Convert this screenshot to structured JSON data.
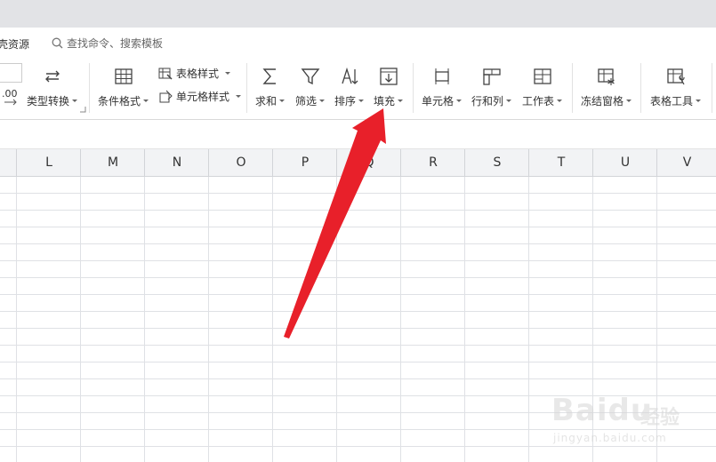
{
  "menu": {
    "resource_fragment": "壳资源",
    "search_placeholder": "查找命令、搜索模板"
  },
  "ribbon": {
    "type_convert": "类型转换",
    "conditional_format": "条件格式",
    "table_style": "表格样式",
    "cell_style": "单元格样式",
    "sum": "求和",
    "filter": "筛选",
    "sort": "排序",
    "fill": "填充",
    "cell": "单元格",
    "row_col": "行和列",
    "worksheet": "工作表",
    "freeze": "冻结窗格",
    "table_tools": "表格工具",
    "decimal_fragment": ".00"
  },
  "columns": [
    "L",
    "M",
    "N",
    "O",
    "P",
    "Q",
    "R",
    "S",
    "T",
    "U",
    "V"
  ],
  "watermark": {
    "brand": "Baidu",
    "cn": "经验",
    "url": "jingyan.baidu.com"
  },
  "colors": {
    "arrow": "#e8202a",
    "titlebar": "#e2e3e6",
    "header": "#f2f3f5",
    "gridline": "#dfe1e5"
  }
}
